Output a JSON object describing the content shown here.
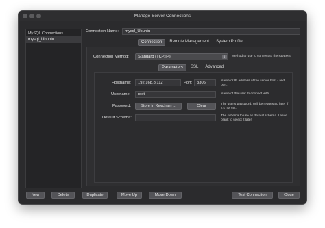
{
  "window": {
    "title": "Manage Server Connections"
  },
  "sidebar": {
    "header": "MySQL Connections",
    "items": [
      {
        "label": "mysql_Ubuntu"
      }
    ]
  },
  "connection_name": {
    "label": "Connection Name:",
    "value": "mysql_Ubuntu"
  },
  "main_tabs": [
    {
      "label": "Connection",
      "active": true
    },
    {
      "label": "Remote Management",
      "active": false
    },
    {
      "label": "System Profile",
      "active": false
    }
  ],
  "connection_method": {
    "label": "Connection Method:",
    "value": "Standard (TCP/IP)",
    "hint": "Method to use to connect to the RDBMS"
  },
  "sub_tabs": [
    {
      "label": "Parameters",
      "active": true
    },
    {
      "label": "SSL",
      "active": false
    },
    {
      "label": "Advanced",
      "active": false
    }
  ],
  "params": {
    "hostname": {
      "label": "Hostname:",
      "value": "192.168.8.112"
    },
    "port": {
      "label": "Port:",
      "value": "3306"
    },
    "host_hint": "Name or IP address of the server host - and port.",
    "username": {
      "label": "Username:",
      "value": "root"
    },
    "username_hint": "Name of the user to connect with.",
    "password": {
      "label": "Password:",
      "store_button": "Store in Keychain ...",
      "clear_button": "Clear"
    },
    "password_hint": "The user's password. Will be requested later if it's not set.",
    "schema": {
      "label": "Default Schema:",
      "value": ""
    },
    "schema_hint": "The schema to use as default schema. Leave blank to select it later."
  },
  "buttons": {
    "new": "New",
    "delete": "Delete",
    "duplicate": "Duplicate",
    "move_up": "Move Up",
    "move_down": "Move Down",
    "test_connection": "Test Connection",
    "close": "Close"
  }
}
